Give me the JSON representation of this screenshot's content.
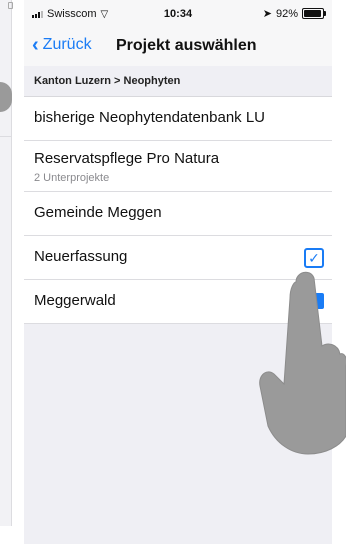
{
  "statusbar": {
    "carrier": "Swisscom",
    "wifi_icon": "wifi-icon",
    "time": "10:34",
    "location_icon": "location-arrow-icon",
    "battery": "92%",
    "battery_level": 0.92
  },
  "navbar": {
    "back_label": "Zurück",
    "title": "Projekt auswählen"
  },
  "section_header": "Kanton Luzern > Neophyten",
  "projects": [
    {
      "title": "bisherige Neophytendatenbank LU",
      "subtitle": "",
      "checked": false
    },
    {
      "title": "Reservatspflege Pro Natura",
      "subtitle": "2 Unterprojekte",
      "checked": false
    },
    {
      "title": "Gemeinde Meggen",
      "subtitle": "",
      "checked": false
    },
    {
      "title": "Neuerfassung",
      "subtitle": "",
      "checked": true
    },
    {
      "title": "Meggerwald",
      "subtitle": "",
      "checked": false
    }
  ],
  "colors": {
    "accent": "#1a7cf5",
    "hand": "#9a9a9a",
    "background": "#efeff4"
  }
}
